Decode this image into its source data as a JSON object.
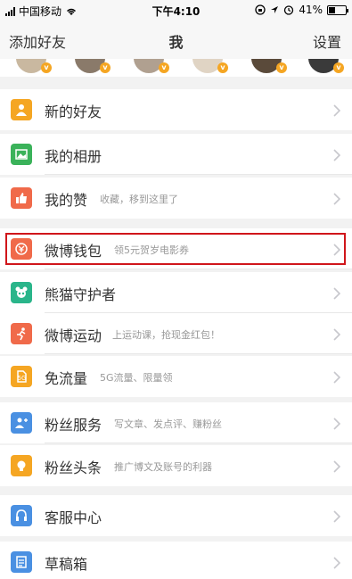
{
  "status_bar": {
    "carrier": "中国移动",
    "time": "下午4:10",
    "battery": "41%",
    "battery_level": 0.41
  },
  "nav": {
    "left": "添加好友",
    "title": "我",
    "right": "设置"
  },
  "menu": [
    {
      "label": "新的好友",
      "sub": "",
      "icon": "person-icon",
      "color": "#f5a623"
    },
    {
      "label": "我的相册",
      "sub": "",
      "icon": "photo-icon",
      "color": "#3ab25a"
    },
    {
      "label": "我的赞",
      "sub": "收藏，移到这里了",
      "icon": "thumbs-up-icon",
      "color": "#f06a4a"
    },
    {
      "label": "微博钱包",
      "sub": "领5元贺岁电影券",
      "icon": "wallet-icon",
      "color": "#f06a4a"
    },
    {
      "label": "熊猫守护者",
      "sub": "",
      "icon": "panda-icon",
      "color": "#2ab58a"
    },
    {
      "label": "微博运动",
      "sub": "上运动课，抢现金红包！",
      "icon": "running-icon",
      "color": "#f06a4a"
    },
    {
      "label": "免流量",
      "sub": "5G流量、限量领",
      "icon": "sim-card-icon",
      "color": "#f5a623"
    },
    {
      "label": "粉丝服务",
      "sub": "写文章、发点评、赚粉丝",
      "icon": "fan-service-icon",
      "color": "#4a90e2"
    },
    {
      "label": "粉丝头条",
      "sub": "推广博文及账号的利器",
      "icon": "lightbulb-icon",
      "color": "#f5a623"
    },
    {
      "label": "客服中心",
      "sub": "",
      "icon": "headset-icon",
      "color": "#4a90e2"
    },
    {
      "label": "草稿箱",
      "sub": "",
      "icon": "drafts-icon",
      "color": "#4a90e2"
    }
  ]
}
